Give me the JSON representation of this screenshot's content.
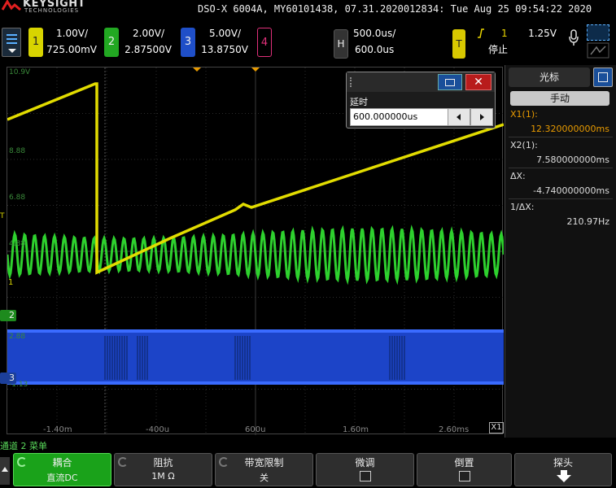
{
  "brand": {
    "name": "KEYSIGHT",
    "sub": "TECHNOLOGIES"
  },
  "title_info": "DSO-X 6004A, MY60101438, 07.31.2020012834: Tue Aug 25 09:54:22 2020",
  "channels": [
    {
      "num": "1",
      "scale": "1.00V/",
      "offset": "725.00mV",
      "color": "#d8d400"
    },
    {
      "num": "2",
      "scale": "2.00V/",
      "offset": "2.87500V",
      "color": "#22c422"
    },
    {
      "num": "3",
      "scale": "5.00V/",
      "offset": "13.8750V",
      "color": "#3a6bff"
    },
    {
      "num": "4",
      "color": "#e0307a"
    }
  ],
  "horizontal": {
    "badge": "H",
    "scale": "500.0us/",
    "delay": "600.0us"
  },
  "trigger": {
    "badge": "T",
    "source": "1",
    "level": "1.25V",
    "state": "停止"
  },
  "y_scale_labels": [
    "10.9V",
    "8.88",
    "6.88",
    "4.88",
    "2.88",
    "-1.13"
  ],
  "x_tick_labels": [
    "-1.40m",
    "-400u",
    "600u",
    "1.60m",
    "2.60ms"
  ],
  "ch_markers": [
    "1",
    "2",
    "3"
  ],
  "trig_marker": "T",
  "x1_marker": "X1",
  "delay_dialog": {
    "label": "延时",
    "value": "600.000000us"
  },
  "cursor_panel": {
    "title": "光标",
    "mode": "手动",
    "x1_label": "X1(1):",
    "x1_value": "12.320000000ms",
    "x2_label": "X2(1):",
    "x2_value": "7.580000000ms",
    "dx_label": "ΔX:",
    "dx_value": "-4.740000000ms",
    "inv_label": "1/ΔX:",
    "inv_value": "210.97Hz"
  },
  "menu_title": "通道 2 菜单",
  "softkeys": [
    {
      "label": "耦合",
      "value": "直流DC"
    },
    {
      "label": "阻抗",
      "value": "1M Ω"
    },
    {
      "label": "带宽限制",
      "value": "关"
    },
    {
      "label": "微调"
    },
    {
      "label": "倒置"
    },
    {
      "label": "探头"
    }
  ]
}
